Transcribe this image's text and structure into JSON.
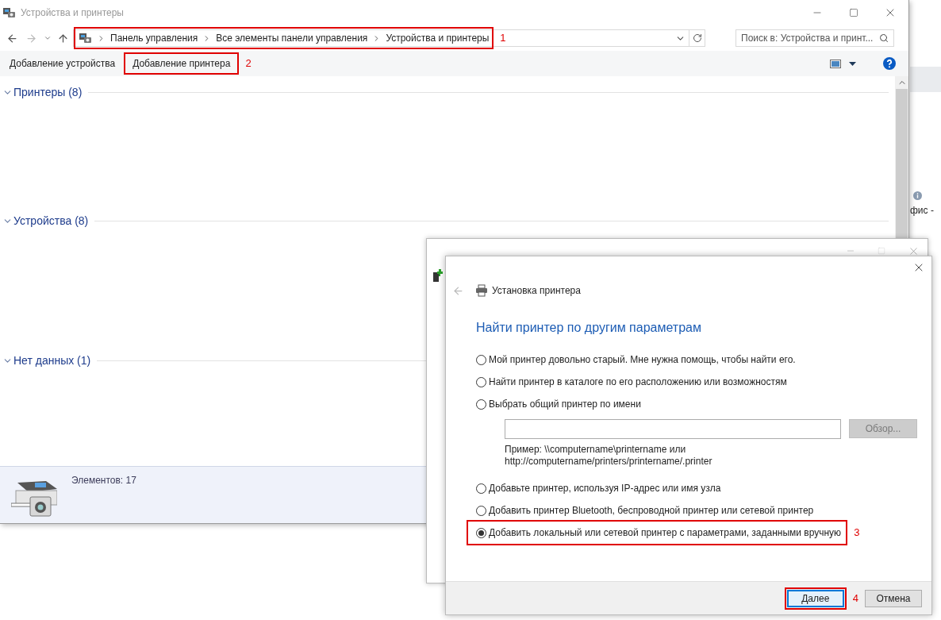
{
  "background_window": {
    "fragments": [
      "фис -"
    ]
  },
  "main_window": {
    "title": "Устройства и принтеры",
    "address": {
      "breadcrumbs": [
        "Панель управления",
        "Все элементы панели управления",
        "Устройства и принтеры"
      ],
      "callout": "1"
    },
    "search": {
      "placeholder": "Поиск в: Устройства и принт..."
    },
    "commands": [
      {
        "label": "Добавление устройства"
      },
      {
        "label": "Добавление принтера",
        "callout": "2"
      }
    ],
    "groups": [
      {
        "label": "Принтеры (8)",
        "expanded": true
      },
      {
        "label": "Устройства (8)",
        "expanded": true
      },
      {
        "label": "Нет данных (1)",
        "expanded": true
      }
    ],
    "details": {
      "count": "Элементов: 17"
    }
  },
  "wizard": {
    "title": "Установка принтера",
    "heading": "Найти принтер по другим параметрам",
    "rows": [
      {
        "kind": "radio",
        "label": "Мой принтер довольно старый. Мне нужна помощь, чтобы найти его.",
        "selected": false
      },
      {
        "kind": "radio",
        "label": "Найти принтер в каталоге по его расположению или возможностям",
        "selected": false
      },
      {
        "kind": "radio",
        "label": "Выбрать общий принтер по имени",
        "selected": false
      },
      {
        "kind": "name_field",
        "button": {
          "label": "Обзор...",
          "disabled": true
        }
      },
      {
        "kind": "example",
        "lines": [
          "Пример: \\\\computername\\printername или",
          "http://computername/printers/printername/.printer"
        ]
      },
      {
        "kind": "radio",
        "label": "Добавьте принтер, используя IP-адрес или имя узла",
        "selected": false
      },
      {
        "kind": "radio",
        "label": "Добавить принтер Bluetooth, беспроводной принтер или сетевой принтер",
        "selected": false
      },
      {
        "kind": "radio",
        "label": "Добавить локальный или сетевой принтер с параметрами, заданными вручную",
        "selected": true,
        "callout": "3"
      }
    ],
    "buttons": [
      {
        "label": "Далее",
        "default": true,
        "callout": "4"
      },
      {
        "label": "Отмена",
        "default": false
      }
    ]
  }
}
